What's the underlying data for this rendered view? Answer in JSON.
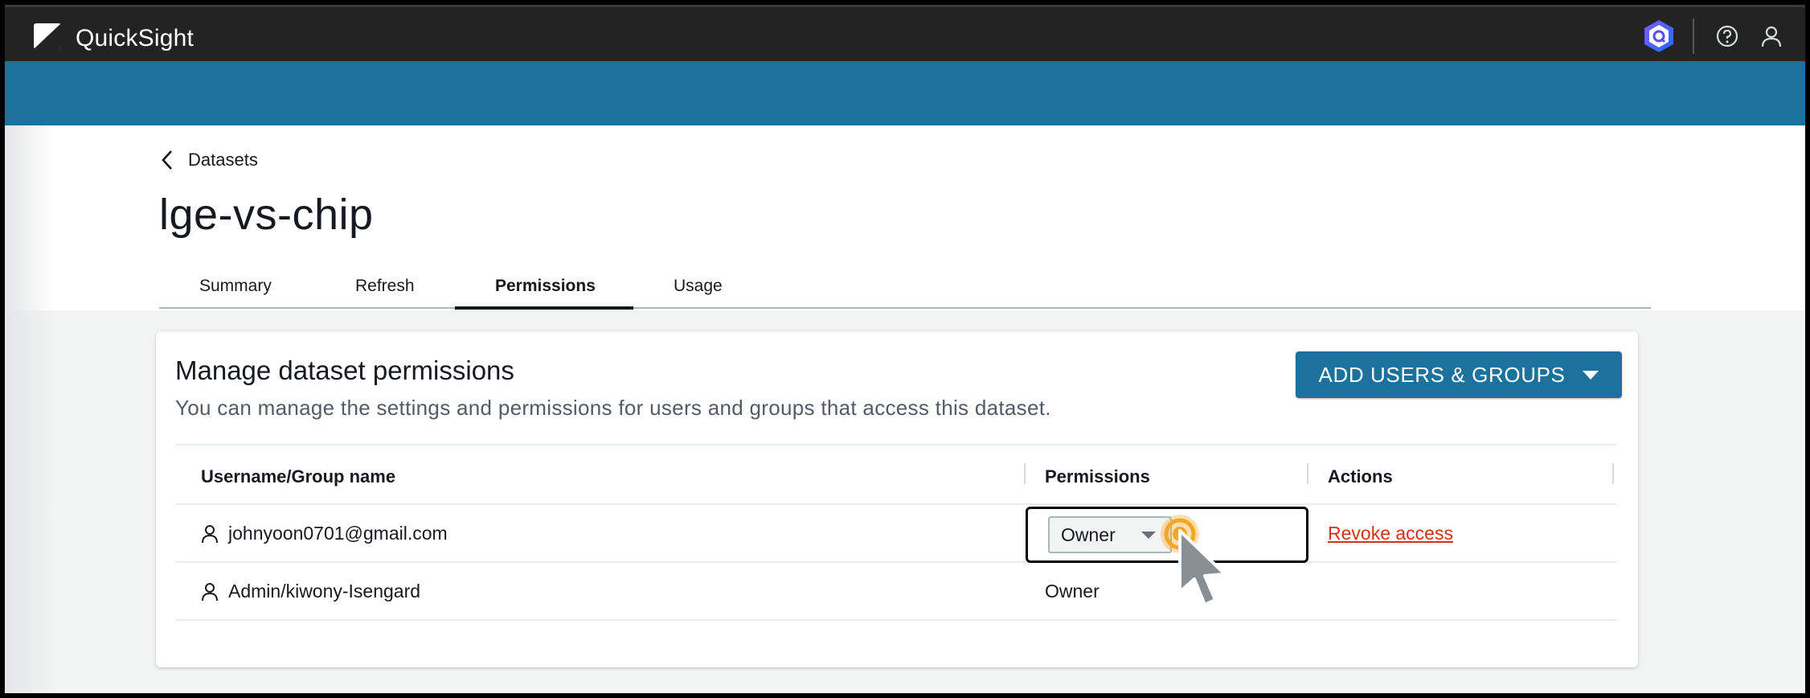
{
  "topbar": {
    "app_name": "QuickSight",
    "icons": [
      "quicksight-logo-icon",
      "hexagon-q-icon",
      "help-icon",
      "user-icon"
    ]
  },
  "breadcrumb": {
    "back_label": "Datasets"
  },
  "page": {
    "title": "lge-vs-chip"
  },
  "tabs": [
    {
      "label": "Summary",
      "active": false
    },
    {
      "label": "Refresh",
      "active": false
    },
    {
      "label": "Permissions",
      "active": true
    },
    {
      "label": "Usage",
      "active": false
    }
  ],
  "card": {
    "title": "Manage dataset permissions",
    "subtitle": "You can manage the settings and permissions for users and groups that access this dataset.",
    "add_button_label": "ADD USERS & GROUPS"
  },
  "table": {
    "headers": {
      "name": "Username/Group name",
      "permissions": "Permissions",
      "actions": "Actions"
    },
    "rows": [
      {
        "name": "johnyoon0701@gmail.com",
        "permission": "Owner",
        "action": "Revoke access",
        "editable": true
      },
      {
        "name": "Admin/kiwony-Isengard",
        "permission": "Owner",
        "action": "",
        "editable": false
      }
    ]
  },
  "colors": {
    "topbar": "#232323",
    "band": "#1a729d",
    "button": "#1a729d",
    "revoke_link": "#d13212",
    "cursor_ring": "#f5a623"
  }
}
